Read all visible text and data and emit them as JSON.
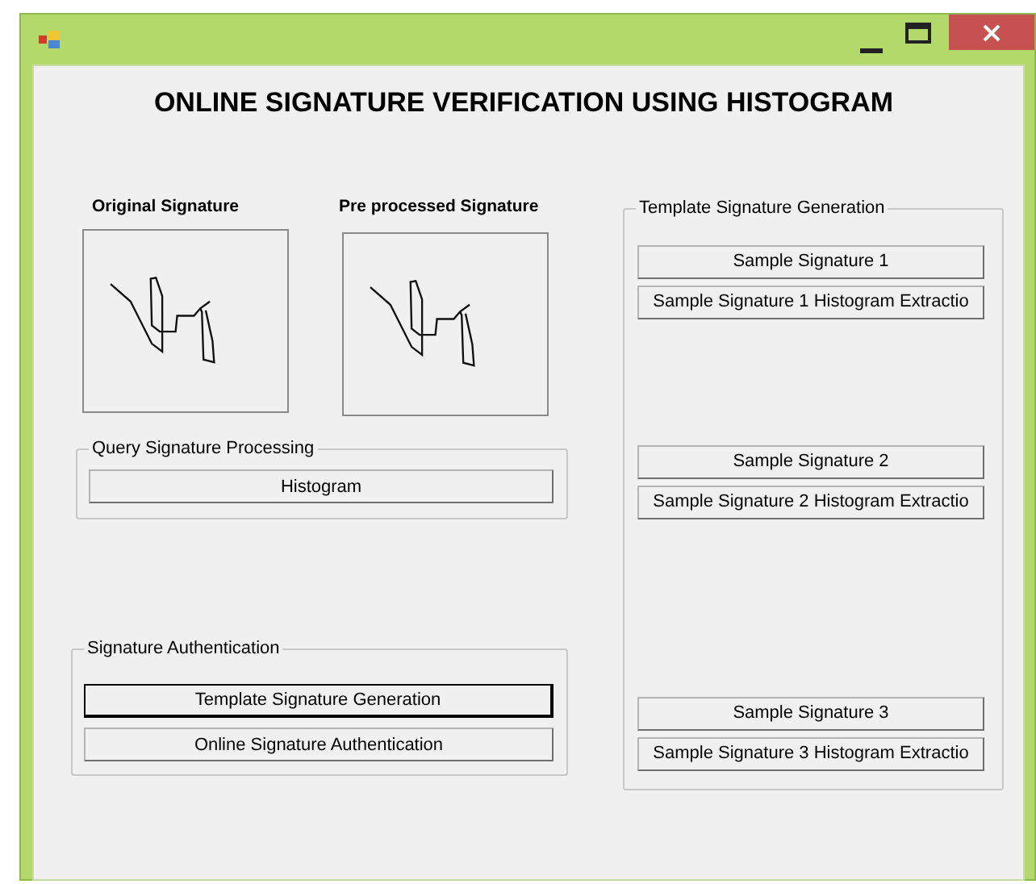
{
  "heading": "ONLINE SIGNATURE VERIFICATION USING HISTOGRAM",
  "images": [
    {
      "label": "Original Signature"
    },
    {
      "label": "Pre processed Signature"
    }
  ],
  "query_group": {
    "title": "Query Signature Processing",
    "buttons": [
      {
        "label": "Histogram",
        "focused": false
      }
    ]
  },
  "auth_group": {
    "title": "Signature Authentication",
    "buttons": [
      {
        "label": "Template Signature Generation",
        "focused": true
      },
      {
        "label": "Online Signature Authentication",
        "focused": false
      }
    ]
  },
  "template_group": {
    "title": "Template Signature Generation",
    "sections": [
      {
        "buttons": [
          {
            "label": "Sample Signature 1",
            "focused": false
          },
          {
            "label": "Sample Signature 1 Histogram Extractio",
            "focused": false
          }
        ]
      },
      {
        "buttons": [
          {
            "label": "Sample Signature 2",
            "focused": false
          },
          {
            "label": "Sample Signature 2 Histogram Extractio",
            "focused": false
          }
        ]
      },
      {
        "buttons": [
          {
            "label": "Sample Signature 3",
            "focused": false
          },
          {
            "label": "Sample Signature 3 Histogram Extractio",
            "focused": false
          }
        ]
      }
    ]
  }
}
